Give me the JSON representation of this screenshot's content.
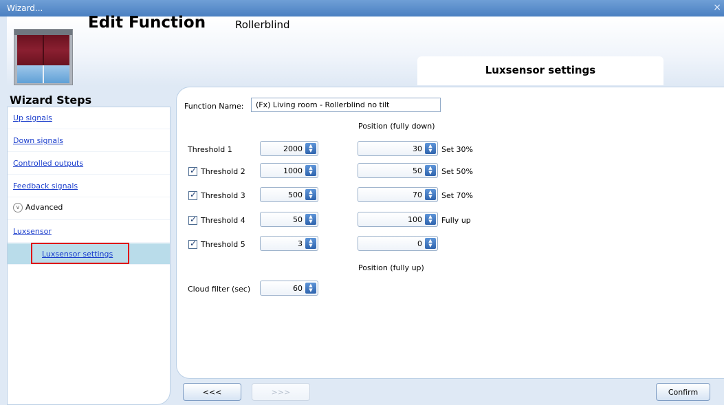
{
  "window": {
    "title": "Wizard...",
    "close": "×"
  },
  "header": {
    "title": "Edit Function",
    "subtitle": "Rollerblind",
    "icon": "rollerblind-window-icon"
  },
  "section": {
    "title": "Luxsensor settings"
  },
  "wizard": {
    "title": "Wizard Steps",
    "steps": [
      {
        "label": "Up signals"
      },
      {
        "label": "Down signals"
      },
      {
        "label": "Controlled outputs"
      },
      {
        "label": "Feedback signals"
      }
    ],
    "advanced_label": "Advanced",
    "advanced_icon": "chevron-down-circle-icon",
    "luxsensor_label": "Luxsensor",
    "sub_label": "Luxsensor settings"
  },
  "form": {
    "function_name_label": "Function Name:",
    "function_name_value": "(Fx) Living room - Rollerblind no tilt",
    "position_down_label": "Position (fully down)",
    "position_up_label": "Position (fully up)",
    "thresholds": [
      {
        "label": "Threshold 1",
        "checkbox": false,
        "value": "2000",
        "position": "30",
        "note": "Set 30%"
      },
      {
        "label": "Threshold 2",
        "checkbox": true,
        "value": "1000",
        "position": "50",
        "note": "Set 50%"
      },
      {
        "label": "Threshold 3",
        "checkbox": true,
        "value": "500",
        "position": "70",
        "note": "Set 70%"
      },
      {
        "label": "Threshold 4",
        "checkbox": true,
        "value": "50",
        "position": "100",
        "note": "Fully up"
      },
      {
        "label": "Threshold 5",
        "checkbox": true,
        "value": "3",
        "position": "0",
        "note": ""
      }
    ],
    "cloud_filter_label": "Cloud filter (sec)",
    "cloud_filter_value": "60"
  },
  "footer": {
    "back": "<<<",
    "next": ">>>",
    "confirm": "Confirm"
  }
}
